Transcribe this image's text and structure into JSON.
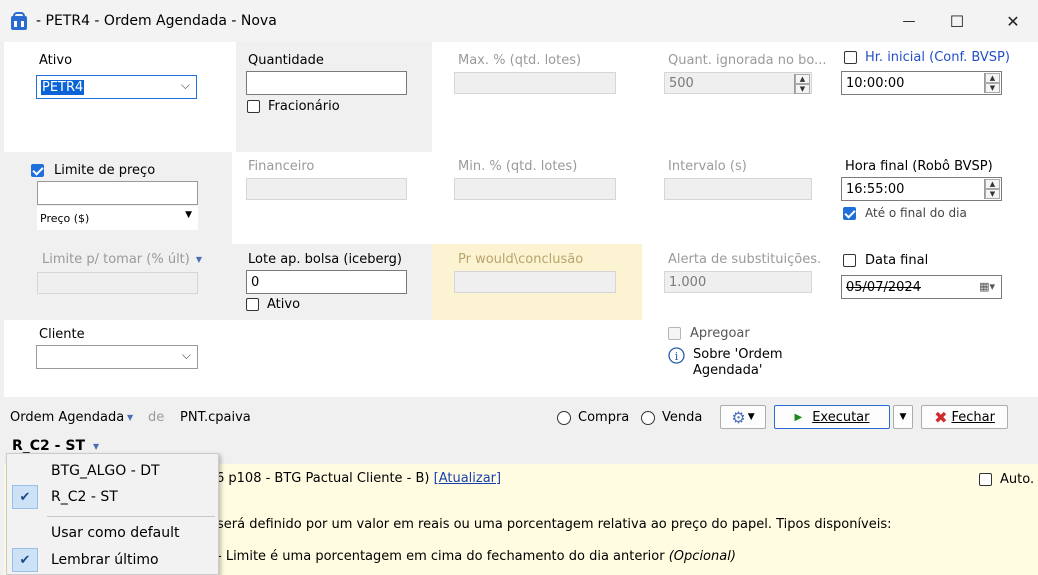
{
  "window": {
    "title": "- PETR4 - Ordem Agendada - Nova",
    "minimize_glyph": "—",
    "maximize_glyph": "☐",
    "close_glyph": "✕"
  },
  "fields": {
    "ativo": {
      "label": "Ativo",
      "value": "PETR4"
    },
    "quantidade": {
      "label": "Quantidade",
      "value": "",
      "fracionario_label": "Fracionário"
    },
    "max_pct": {
      "label": "Max. % (qtd. lotes)",
      "value": ""
    },
    "quant_ignorada": {
      "label": "Quant. ignorada no bo...",
      "value": "500"
    },
    "hr_inicial": {
      "label": "Hr. inicial (Conf. BVSP)",
      "value": "10:00:00"
    },
    "limite_preco": {
      "label": "Limite de preço",
      "value": "",
      "type_value": "Preço ($)"
    },
    "financeiro": {
      "label": "Financeiro",
      "value": ""
    },
    "min_pct": {
      "label": "Min. % (qtd. lotes)",
      "value": ""
    },
    "intervalo": {
      "label": "Intervalo (s)",
      "value": ""
    },
    "hora_final": {
      "label": "Hora final (Robô BVSP)",
      "value": "16:55:00",
      "ate_final_label": "Até o final do dia"
    },
    "limite_tomar": {
      "label": "Limite p/ tomar (% últ)",
      "value": ""
    },
    "lote_bolsa": {
      "label": "Lote ap. bolsa (iceberg)",
      "value": "0",
      "ativo_label": "Ativo"
    },
    "pr_would": {
      "label": "Pr would\\conclusão",
      "value": ""
    },
    "alerta_subst": {
      "label": "Alerta de substituições.",
      "value": "1.000"
    },
    "data_final": {
      "label": "Data final",
      "value": "05/07/2024"
    },
    "cliente": {
      "label": "Cliente",
      "value": ""
    },
    "apregoar_label": "Apregoar",
    "sobre_label": "Sobre 'Ordem Agendada'"
  },
  "bottombar": {
    "ordem_agendada": "Ordem Agendada",
    "de": "de",
    "user": "PNT.cpaiva",
    "compra": "Compra",
    "venda": "Venda",
    "executar": "Executar",
    "fechar": "Fechar",
    "strategy": "R_C2 - ST"
  },
  "info": {
    "account_prefix": "6 p108 - BTG Pactual Cliente - B) ",
    "atualizar": "[Atualizar]",
    "auto": "Auto.",
    "line1": "será definido por um valor em reais ou uma porcentagem relativa ao preço do papel. Tipos disponíveis:",
    "line2": "- Limite é uma porcentagem em cima do fechamento do dia anterior",
    "line2_italic": "(Opcional)"
  },
  "menu": {
    "items": [
      {
        "label": "BTG_ALGO - DT",
        "checked": false
      },
      {
        "label": "R_C2 - ST",
        "checked": true
      },
      {
        "label": "Usar como default",
        "checked": false
      },
      {
        "label": "Lembrar último",
        "checked": true
      }
    ]
  },
  "icons": [
    "app-icon",
    "dropdown-arrow-icon",
    "spin-up-icon",
    "spin-down-icon",
    "calendar-icon",
    "info-icon",
    "gear-icon",
    "play-icon",
    "close-x-icon",
    "check-icon"
  ],
  "colors": {
    "accent": "#1e6fd9",
    "link": "#2350c9",
    "highlight": "#fcf3d2",
    "info_bg": "#fffce1"
  }
}
